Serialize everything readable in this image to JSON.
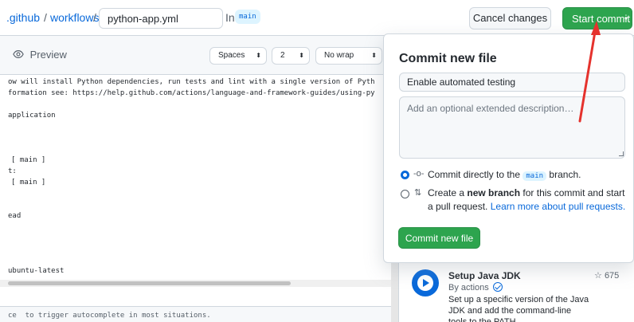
{
  "breadcrumb": {
    "segment_github": ".github",
    "sep1": "/",
    "segment_workflows": "workflows",
    "sep2": "/",
    "filename_value": "python-app.yml",
    "in_label": "In",
    "branch": "main"
  },
  "header_actions": {
    "cancel_label": "Cancel changes",
    "start_commit_label": "Start commit",
    "start_commit_caret": "▾"
  },
  "toolbar": {
    "preview_label": "Preview",
    "indent_mode": "Spaces",
    "indent_size": "2",
    "wrap_mode": "No wrap",
    "select_caret": "⬍"
  },
  "editor": {
    "lines": [
      "ow will install Python dependencies, run tests and lint with a single version of Pyth",
      "formation see: https://help.github.com/actions/language-and-framework-guides/using-py",
      "application",
      "[ main ]",
      "t:",
      "[ main ]",
      "ead",
      "ubuntu-latest"
    ],
    "footer_hint": "ce  to trigger autocomplete in most situations."
  },
  "commit_panel": {
    "title": "Commit new file",
    "summary_value": "Enable automated testing",
    "description_placeholder": "Add an optional extended description…",
    "option_direct": {
      "icon": "-o-",
      "prefix": "Commit directly to the",
      "branch": "main",
      "suffix": "branch."
    },
    "option_new_branch": {
      "icon": "⇅",
      "prefix": "Create a",
      "bold": "new branch",
      "suffix": "for this commit and start a pull request.",
      "link": "Learn more about pull requests."
    },
    "commit_button": "Commit new file"
  },
  "marketplace": {
    "action_title": "Setup Java JDK",
    "action_by": "By actions",
    "stars": "675",
    "star_icon": "☆",
    "description": "Set up a specific version of the Java JDK and add the command-line tools to the PATH"
  },
  "colors": {
    "accent_blue": "#0969da",
    "primary_green": "#2da44e",
    "annotation_red": "#e5322d"
  }
}
